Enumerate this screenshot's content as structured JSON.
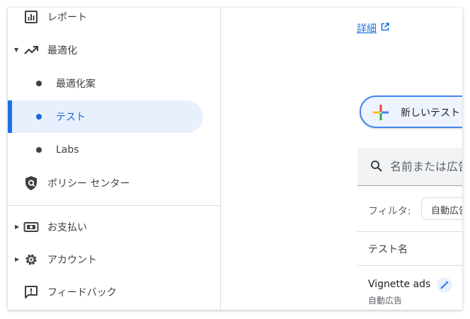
{
  "colors": {
    "accent": "#1a73e8",
    "selected_bg": "#e8f0fe",
    "selected_text": "#1967d2",
    "divider": "#dadce0"
  },
  "sidebar": {
    "items": [
      {
        "label": "レポート",
        "icon": "bar-chart-icon"
      },
      {
        "label": "最適化",
        "icon": "trending-up-icon",
        "expanded": true
      },
      {
        "label": "最適化案",
        "icon": "bullet-icon"
      },
      {
        "label": "テスト",
        "icon": "bullet-icon",
        "selected": true
      },
      {
        "label": "Labs",
        "icon": "bullet-icon"
      },
      {
        "label": "ポリシー センター",
        "icon": "shield-icon"
      },
      {
        "label": "お支払い",
        "icon": "payments-icon",
        "expanded": false
      },
      {
        "label": "アカウント",
        "icon": "gear-icon",
        "expanded": false
      },
      {
        "label": "フィードバック",
        "icon": "feedback-icon"
      }
    ]
  },
  "main": {
    "details_link": "詳細",
    "new_test_button": "新しいテスト",
    "search": {
      "placeholder": "名前または広告"
    },
    "filter": {
      "label": "フィルタ:",
      "chip": "自動広告"
    },
    "table": {
      "column_header": "テスト名",
      "rows": [
        {
          "name": "Vignette ads",
          "type": "自動広告"
        }
      ]
    }
  }
}
